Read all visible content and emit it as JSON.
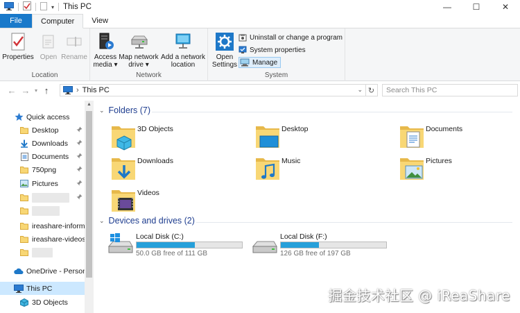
{
  "window": {
    "title": "This PC",
    "minimize_glyph": "—",
    "maximize_glyph": "☐",
    "close_glyph": "✕"
  },
  "ribbon": {
    "tabs": [
      {
        "label": "File"
      },
      {
        "label": "Computer"
      },
      {
        "label": "View"
      }
    ],
    "groups": {
      "location": {
        "label": "Location",
        "properties": "Properties",
        "open": "Open",
        "rename": "Rename"
      },
      "network": {
        "label": "Network",
        "access_media": [
          "Access",
          "media ▾"
        ],
        "map_network_drive": [
          "Map network",
          "drive ▾"
        ],
        "add_network_location": [
          "Add a network",
          "location"
        ]
      },
      "system": {
        "label": "System",
        "open_settings": [
          "Open",
          "Settings"
        ],
        "uninstall": "Uninstall or change a program",
        "system_properties": "System properties",
        "manage": "Manage"
      }
    }
  },
  "address": {
    "path": "This PC",
    "separator": "›",
    "search_placeholder": "Search This PC"
  },
  "nav": {
    "quick_access": "Quick access",
    "items": [
      {
        "label": "Desktop",
        "icon": "desktop-folder-icon",
        "pinned": true
      },
      {
        "label": "Downloads",
        "icon": "downloads-icon",
        "pinned": true
      },
      {
        "label": "Documents",
        "icon": "documents-icon",
        "pinned": true
      },
      {
        "label": "750png",
        "icon": "folder-icon",
        "pinned": true
      },
      {
        "label": "Pictures",
        "icon": "pictures-icon",
        "pinned": true
      },
      {
        "label": "",
        "icon": "folder-icon",
        "pinned": true,
        "blurred": true
      },
      {
        "label": "",
        "icon": "folder-icon",
        "pinned": false,
        "blurred": true
      },
      {
        "label": "ireashare-informa",
        "icon": "folder-icon",
        "pinned": false
      },
      {
        "label": "ireashare-videos-a",
        "icon": "folder-icon",
        "pinned": false
      },
      {
        "label": "",
        "icon": "folder-icon",
        "pinned": false,
        "blurred": true
      }
    ],
    "onedrive": "OneDrive - Persona",
    "this_pc": "This PC",
    "objects_3d": "3D Objects"
  },
  "content": {
    "folders_header": "Folders (7)",
    "folders": [
      {
        "name": "3D Objects",
        "icon": "3d-objects-icon"
      },
      {
        "name": "Desktop",
        "icon": "desktop-folder-icon"
      },
      {
        "name": "Documents",
        "icon": "documents-folder-icon"
      },
      {
        "name": "Downloads",
        "icon": "downloads-folder-icon"
      },
      {
        "name": "Music",
        "icon": "music-folder-icon"
      },
      {
        "name": "Pictures",
        "icon": "pictures-folder-icon"
      },
      {
        "name": "Videos",
        "icon": "videos-folder-icon"
      }
    ],
    "drives_header": "Devices and drives (2)",
    "drives": [
      {
        "name": "Local Disk (C:)",
        "free": "50.0 GB free of 111 GB",
        "used_fraction": 0.55
      },
      {
        "name": "Local Disk (F:)",
        "free": "126 GB free of 197 GB",
        "used_fraction": 0.36
      }
    ]
  },
  "watermark": "掘金技术社区 @ iReaShare",
  "colors": {
    "file_tab": "#1979ca",
    "header_text": "#1e3d8f",
    "selection": "#cce8ff",
    "drive_bar": "#26a0da",
    "folder_yellow": "#f8d775"
  }
}
